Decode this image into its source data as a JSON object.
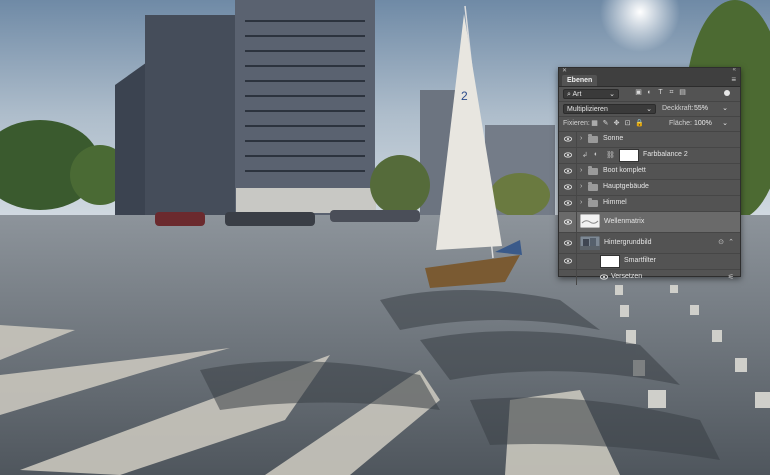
{
  "panel": {
    "tab_label": "Ebenen",
    "filter_value": "Art",
    "blend_mode": "Multiplizieren",
    "opacity_label": "Deckkraft:",
    "opacity_value": "55%",
    "lock_label": "Fixieren:",
    "fill_label": "Fläche:",
    "fill_value": "100%",
    "layers": [
      {
        "name": "Sonne",
        "type": "group"
      },
      {
        "name": "Farbbalance 2",
        "type": "adjustment"
      },
      {
        "name": "Boot komplett",
        "type": "group"
      },
      {
        "name": "Hauptgebäude",
        "type": "group"
      },
      {
        "name": "Himmel",
        "type": "group"
      },
      {
        "name": "Wellenmatrix",
        "type": "layer",
        "selected": true
      },
      {
        "name": "Hintergrundbild",
        "type": "smart-object"
      },
      {
        "name": "Smartfilter",
        "type": "filter-mask"
      },
      {
        "name": "Versetzen",
        "type": "filter"
      }
    ]
  },
  "colors": {
    "panel_bg": "#535353",
    "selected_row": "#6a6a6a"
  }
}
